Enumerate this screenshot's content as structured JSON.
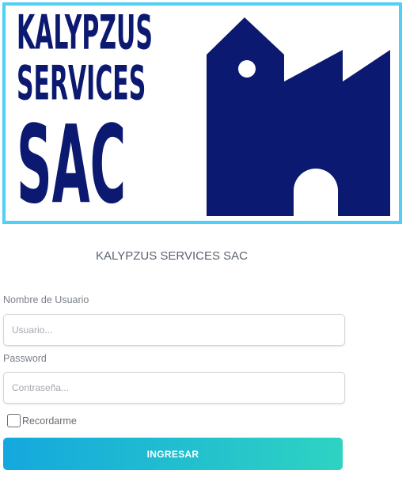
{
  "logo": {
    "line1": "KALYPZUS",
    "line2": "SERVICES",
    "line3": "SAC",
    "brand_color": "#0c1970",
    "border_color": "#4fd0f4",
    "icon": "factory-building-icon"
  },
  "company_name": "KALYPZUS SERVICES SAC",
  "form": {
    "username_label": "Nombre de Usuario",
    "username_placeholder": "Usuario...",
    "username_value": "",
    "password_label": "Password",
    "password_placeholder": "Contraseña...",
    "password_value": "",
    "remember_label": "Recordarme",
    "remember_checked": false,
    "submit_label": "INGRESAR"
  }
}
